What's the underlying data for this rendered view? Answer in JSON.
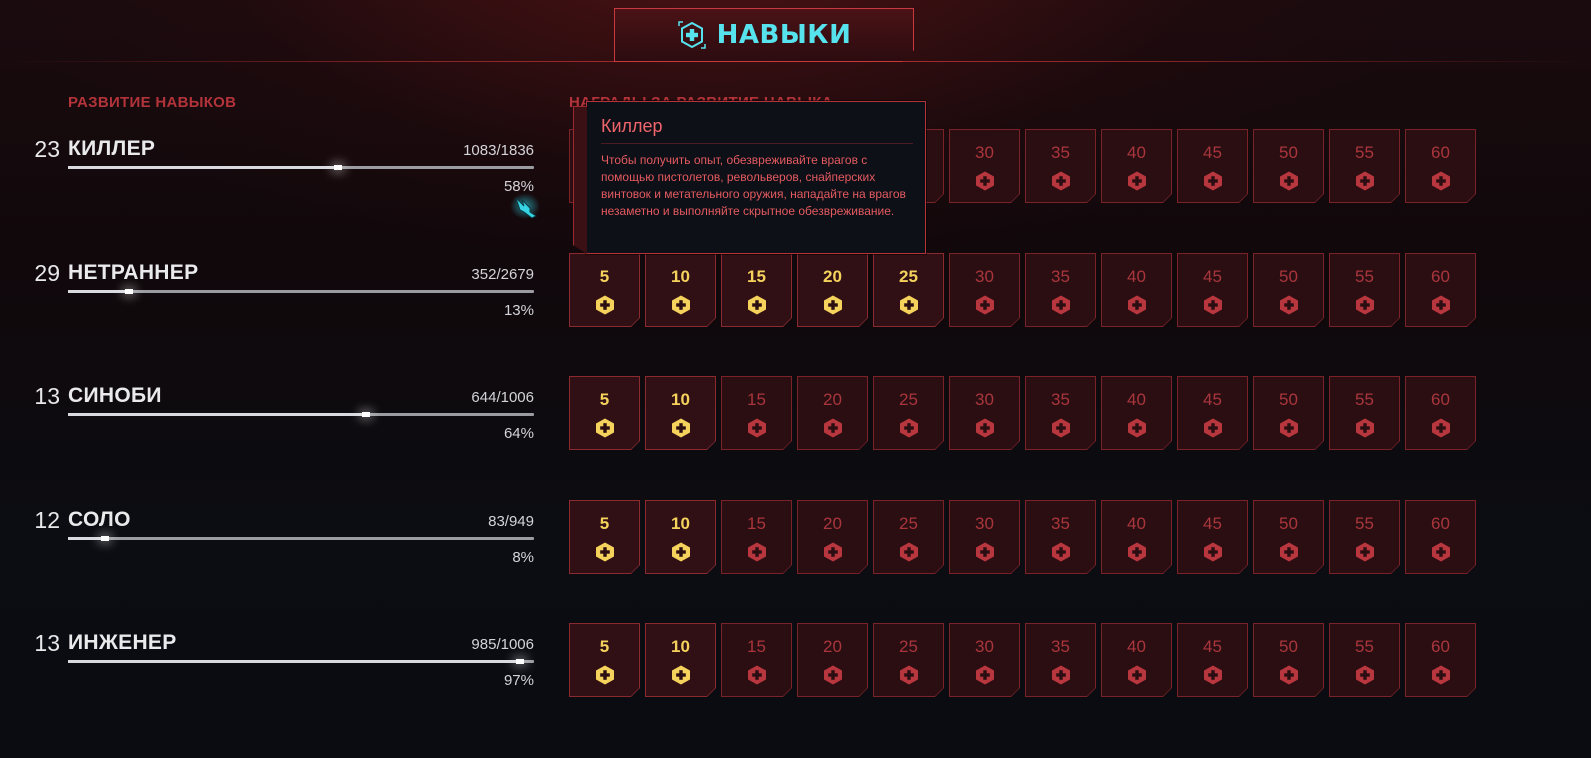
{
  "tab": {
    "label": "НАВЫКИ",
    "icon": "skills-hex-plus-icon"
  },
  "sections": {
    "progress_title": "РАЗВИТИЕ НАВЫКОВ",
    "rewards_title": "НАГРАДЫ ЗА РАЗВИТИЕ НАВЫКА"
  },
  "skills": [
    {
      "level": "23",
      "name": "КИЛЛЕР",
      "xp": "1083/1836",
      "percent": "58%",
      "progress": 0.58,
      "unlocked_count": 0
    },
    {
      "level": "29",
      "name": "НЕТРАННЕР",
      "xp": "352/2679",
      "percent": "13%",
      "progress": 0.13,
      "unlocked_count": 5
    },
    {
      "level": "13",
      "name": "СИНОБИ",
      "xp": "644/1006",
      "percent": "64%",
      "progress": 0.64,
      "unlocked_count": 2
    },
    {
      "level": "12",
      "name": "СОЛО",
      "xp": "83/949",
      "percent": "8%",
      "progress": 0.08,
      "unlocked_count": 2
    },
    {
      "level": "13",
      "name": "ИНЖЕНЕР",
      "xp": "985/1006",
      "percent": "97%",
      "progress": 0.97,
      "unlocked_count": 2
    }
  ],
  "reward_levels": [
    "5",
    "10",
    "15",
    "20",
    "25",
    "30",
    "35",
    "40",
    "45",
    "50",
    "55",
    "60"
  ],
  "tooltip": {
    "title": "Киллер",
    "description": "Чтобы получить опыт, обезвреживайте врагов с помощью пистолетов, револьверов, снайперских винтовок и метательного оружия, нападайте на врагов незаметно и выполняйте скрытное обезвреживание."
  },
  "colors": {
    "accent_cyan": "#57e3ee",
    "accent_red": "#b2333a",
    "unlocked_yellow": "#f4d25c",
    "locked_red": "#a9363c"
  }
}
